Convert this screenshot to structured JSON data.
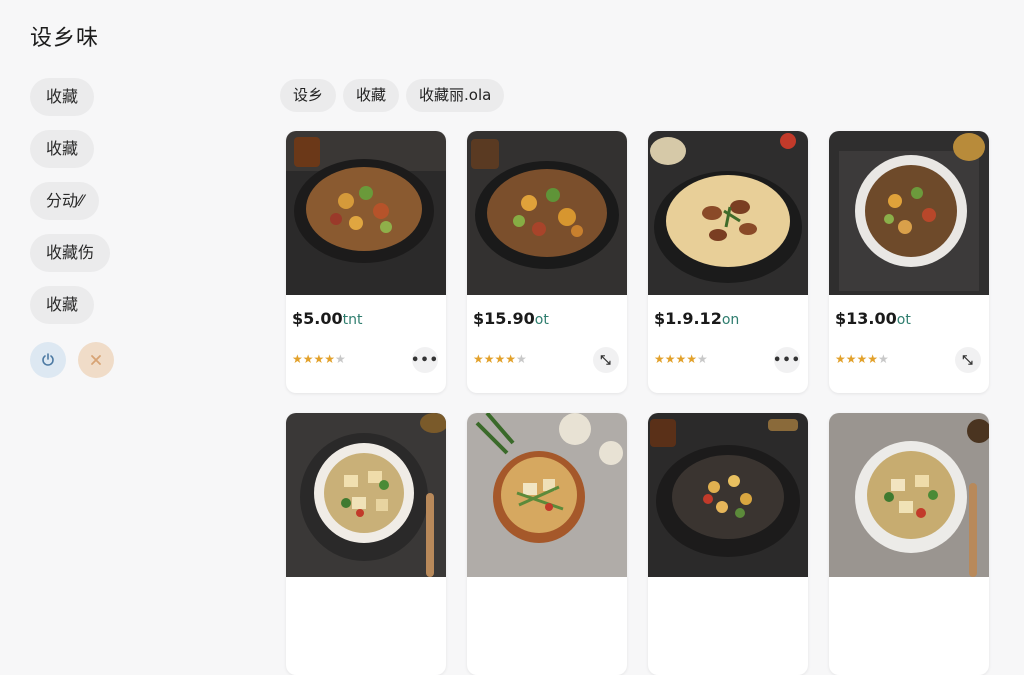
{
  "app": {
    "title": "设乡味"
  },
  "sidebar": {
    "items": [
      {
        "label": "收藏"
      },
      {
        "label": "收藏"
      },
      {
        "label": "分动⁄⁄"
      },
      {
        "label": "收藏伤"
      },
      {
        "label": "收藏"
      }
    ],
    "refresh_icon": "refresh-icon",
    "close_icon": "close-icon"
  },
  "filters": [
    {
      "label": "设乡"
    },
    {
      "label": "收藏"
    },
    {
      "label": "收藏丽.ola"
    }
  ],
  "products": [
    {
      "price": "$5.00",
      "suffix": "tnt",
      "rating": 4,
      "action": "more-icon"
    },
    {
      "price": "$15.90",
      "suffix": "ot",
      "rating": 4,
      "action": "expand-icon"
    },
    {
      "price": "$1.9.12",
      "suffix": "on",
      "rating": 4,
      "action": "more-icon"
    },
    {
      "price": "$13.00",
      "suffix": "ot",
      "rating": 4,
      "action": "expand-icon"
    },
    {
      "price": "",
      "suffix": "",
      "rating": 0,
      "action": ""
    },
    {
      "price": "",
      "suffix": "",
      "rating": 0,
      "action": ""
    },
    {
      "price": "",
      "suffix": "",
      "rating": 0,
      "action": ""
    },
    {
      "price": "",
      "suffix": "",
      "rating": 0,
      "action": ""
    }
  ],
  "colors": {
    "star": "#e2a12b",
    "price_suffix": "#2e7d6e"
  }
}
